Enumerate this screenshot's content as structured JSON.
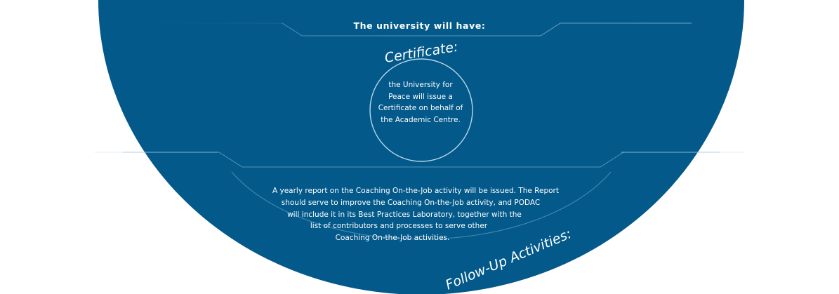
{
  "heading": "The university will have:",
  "certificate": {
    "title": "Certificate:",
    "text": "the University for Peace will issue a Certificate on behalf of the Academic Centre."
  },
  "follow_up": {
    "title": "Follow-Up Activities:",
    "lines": [
      "A yearly report on the Coaching On-the-Job activity will be issued. The Report",
      "should serve to improve the Coaching On-the-Job activity, and PODAC",
      "will include it in its Best Practices Laboratory, together with the",
      "list of contributors and processes to serve other",
      "Coaching On-the-Job activities."
    ]
  },
  "colors": {
    "background": "#ffffff",
    "panel": "#03598a",
    "text": "#ffffff",
    "outline": "#9ec5dc"
  }
}
